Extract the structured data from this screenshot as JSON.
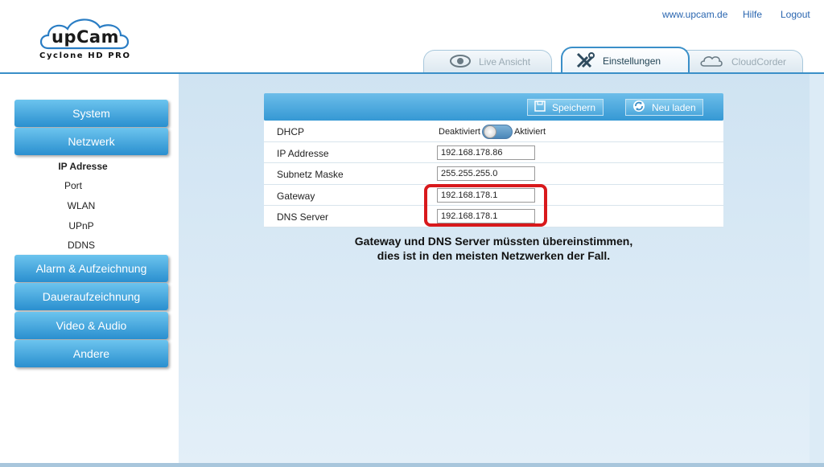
{
  "header": {
    "logo_text": "upCam",
    "logo_sub": "Cyclone HD PRO",
    "links": {
      "www": "www.upcam.de",
      "help": "Hilfe",
      "logout": "Logout"
    }
  },
  "tabs": [
    {
      "label": "Live Ansicht",
      "icon": "eye-icon",
      "active": false
    },
    {
      "label": "Einstellungen",
      "icon": "tools-icon",
      "active": true
    },
    {
      "label": "CloudCorder",
      "icon": "cloud-icon",
      "active": false
    }
  ],
  "sidebar": {
    "items": [
      {
        "label": "System"
      },
      {
        "label": "Netzwerk"
      },
      {
        "label": "Alarm & Aufzeichnung"
      },
      {
        "label": "Daueraufzeichnung"
      },
      {
        "label": "Video & Audio"
      },
      {
        "label": "Andere"
      }
    ],
    "subitems": [
      {
        "label": "IP Adresse",
        "active": true
      },
      {
        "label": "Port"
      },
      {
        "label": "WLAN"
      },
      {
        "label": "UPnP"
      },
      {
        "label": "DDNS"
      }
    ]
  },
  "toolbar": {
    "save_label": "Speichern",
    "reload_label": "Neu laden"
  },
  "form": {
    "dhcp_label": "DHCP",
    "dhcp_off": "Deaktiviert",
    "dhcp_on": "Aktiviert",
    "ip_label": "IP Addresse",
    "ip_value": "192.168.178.86",
    "subnet_label": "Subnetz Maske",
    "subnet_value": "255.255.255.0",
    "gateway_label": "Gateway",
    "gateway_value": "192.168.178.1",
    "dns_label": "DNS Server",
    "dns_value": "192.168.178.1"
  },
  "note": {
    "line1": "Gateway und DNS Server müssten übereinstimmen,",
    "line2": "dies ist in den meisten Netzwerken der Fall."
  },
  "colors": {
    "accent": "#3598d4",
    "highlight": "#d8191c",
    "link": "#2a66b0"
  }
}
